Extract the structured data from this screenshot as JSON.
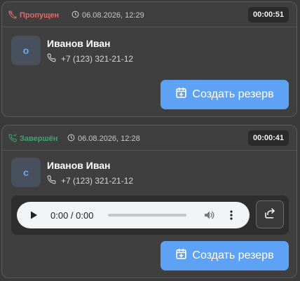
{
  "calls": [
    {
      "status": "Пропущен",
      "status_type": "missed",
      "status_color": "#e26a6a",
      "status_icon": "missed-call-icon",
      "date": "06.08.2026, 12:29",
      "duration": "00:00:51",
      "avatar_letter": "о",
      "name": "Иванов Иван",
      "phone": "+7 (123) 321-21-12",
      "button_label": "Создать резерв"
    },
    {
      "status": "Завершён",
      "status_type": "completed",
      "status_color": "#3fa56f",
      "status_icon": "completed-call-icon",
      "date": "06.08.2026, 12:28",
      "duration": "00:00:41",
      "avatar_letter": "с",
      "name": "Иванов Иван",
      "phone": "+7 (123) 321-21-12",
      "audio": {
        "time": "0:00 / 0:00",
        "progress": 0
      },
      "button_label": "Создать резерв"
    }
  ],
  "colors": {
    "accent": "#5ea2f5",
    "background": "#3a3a3a",
    "card": "#3f3f3f"
  }
}
